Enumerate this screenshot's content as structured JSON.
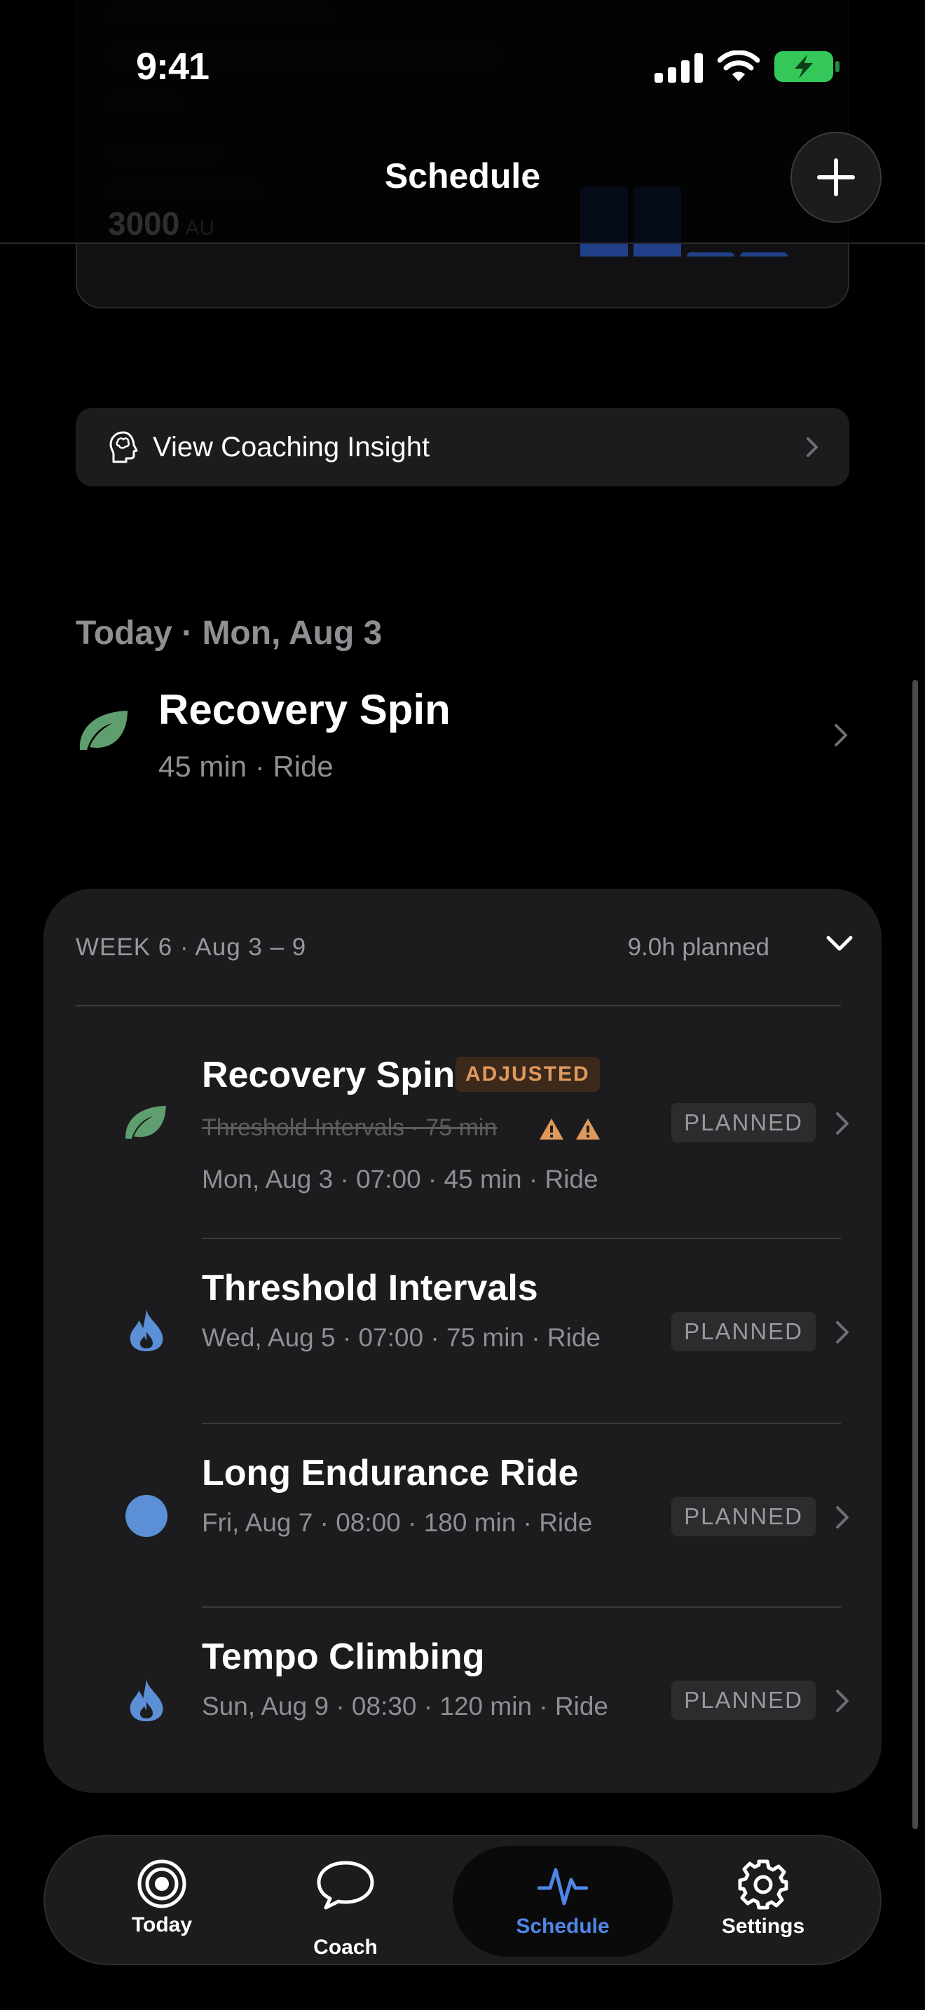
{
  "status_bar": {
    "time": "9:41"
  },
  "header": {
    "title": "Schedule"
  },
  "load_card": {
    "value": "3000",
    "unit": "AU"
  },
  "insight": {
    "label": "View Coaching Insight"
  },
  "today": {
    "header": "Today · Mon, Aug 3",
    "title": "Recovery Spin",
    "subtitle": "45 min · Ride"
  },
  "week": {
    "label": "WEEK 6  ·  Aug 3 – 9",
    "planned": "9.0h planned",
    "rows": [
      {
        "title": "Recovery Spin",
        "badge_adjusted": "ADJUSTED",
        "previous": "Threshold Intervals · 75 min",
        "subtitle": "Mon, Aug 3 · 07:00 · 45 min · Ride",
        "status": "PLANNED",
        "icon": "leaf-icon"
      },
      {
        "title": "Threshold Intervals",
        "subtitle": "Wed, Aug 5 · 07:00 · 75 min · Ride",
        "status": "PLANNED",
        "icon": "flame-icon"
      },
      {
        "title": "Long Endurance Ride",
        "subtitle": "Fri, Aug 7 · 08:00 · 180 min · Ride",
        "status": "PLANNED",
        "icon": "circle-icon"
      },
      {
        "title": "Tempo Climbing",
        "subtitle": "Sun, Aug 9 · 08:30 · 120 min · Ride",
        "status": "PLANNED",
        "icon": "flame-icon"
      }
    ]
  },
  "tabs": [
    {
      "label": "Today",
      "icon": "target-icon"
    },
    {
      "label": "Coach",
      "icon": "chat-bubble-icon"
    },
    {
      "label": "Schedule",
      "icon": "pulse-icon",
      "active": true
    },
    {
      "label": "Settings",
      "icon": "gear-icon"
    }
  ],
  "colors": {
    "accent": "#4f86e8",
    "leaf": "#5f9e6e",
    "flame": "#5b8fd6",
    "warning": "#e0995c",
    "battery": "#34c759"
  }
}
